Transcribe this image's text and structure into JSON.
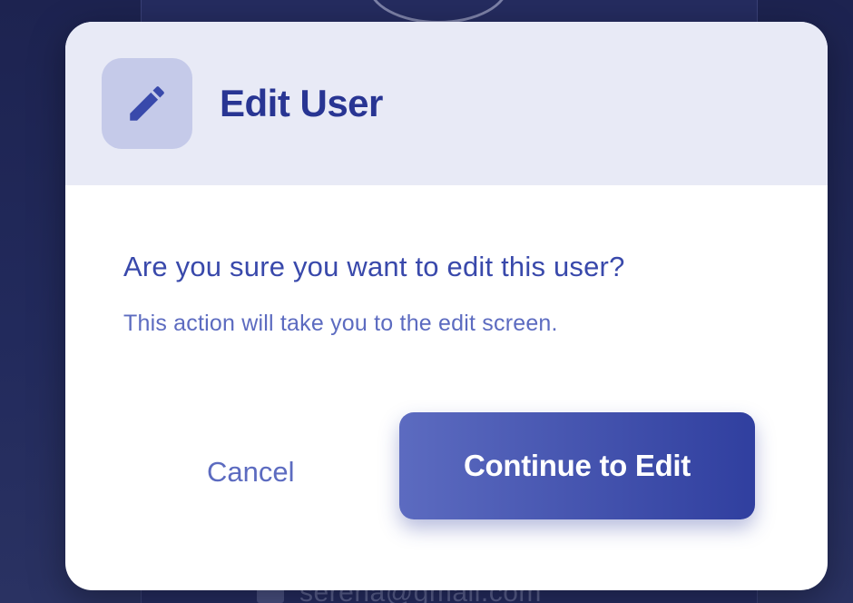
{
  "backdrop": {
    "email_text": "serena@gmail.com"
  },
  "modal": {
    "header": {
      "icon": "pencil-icon",
      "title": "Edit User"
    },
    "body": {
      "question": "Are you sure you want to edit this user?",
      "subtext": "This action will take you to the edit screen."
    },
    "actions": {
      "cancel_label": "Cancel",
      "continue_label": "Continue to Edit"
    }
  },
  "colors": {
    "header_bg": "#e8eaf6",
    "icon_box_bg": "#c5cae9",
    "title_color": "#283593",
    "primary_gradient_start": "#5c6bc0",
    "primary_gradient_end": "#303f9f"
  }
}
